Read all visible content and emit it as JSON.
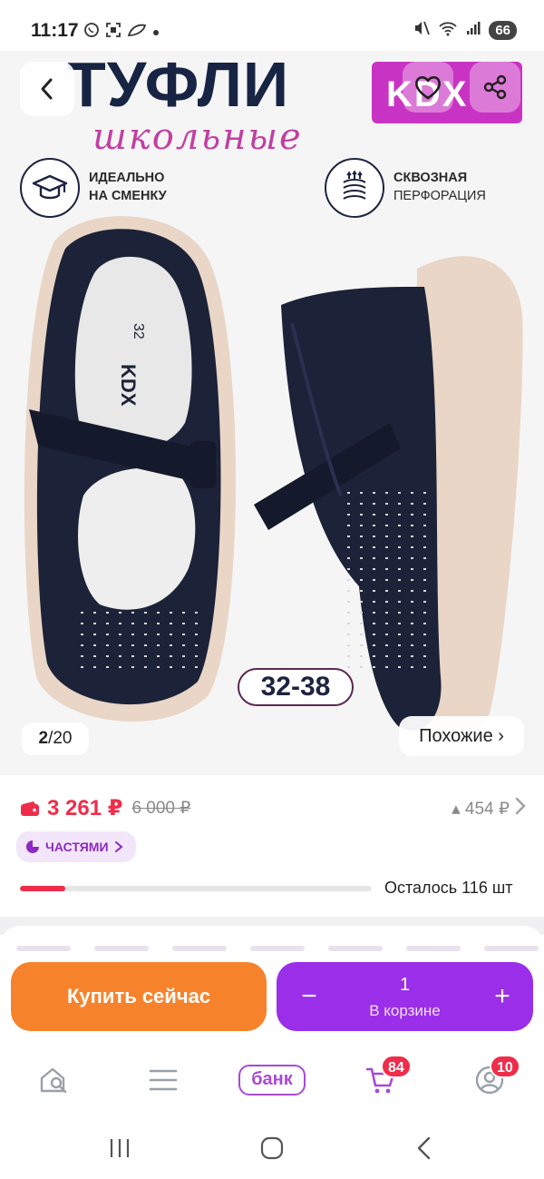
{
  "status_bar": {
    "time": "11:17",
    "battery": "66",
    "left_icons": [
      "whatsapp-icon",
      "scan-icon",
      "leaf-icon",
      "dot-icon"
    ],
    "right_icons": [
      "mute-icon",
      "wifi-icon",
      "signal-icon"
    ]
  },
  "gallery": {
    "hero_title": "ТУФЛИ",
    "hero_subtitle": "школьные",
    "brand_logo": "KDX",
    "features": [
      {
        "line1": "ИДЕАЛЬНО",
        "line2": "НА СМЕНКУ",
        "icon": "graduation-cap-icon"
      },
      {
        "line1": "СКВОЗНАЯ",
        "line2": "ПЕРФОРАЦИЯ",
        "icon": "perforation-icon"
      }
    ],
    "size_range": "32-38",
    "insole_size": "32",
    "insole_brand": "KDX",
    "photo_index": "2",
    "photo_total": "20",
    "similar_label": "Похожие ›"
  },
  "price": {
    "current": "3 261 ₽",
    "old": "6 000 ₽",
    "drop": "▴ 454 ₽",
    "parts_label": "ЧАСТЯМИ",
    "stock_text": "Осталось 116 шт",
    "stock_fraction": 0.13
  },
  "actions": {
    "buy_now": "Купить сейчас",
    "cart_qty": "1",
    "cart_label": "В корзине",
    "minus": "−",
    "plus": "+"
  },
  "tab_bar": {
    "bank_label": "банк",
    "cart_badge": "84",
    "profile_badge": "10"
  },
  "colors": {
    "accent_purple": "#9b2ee8",
    "buy_orange": "#f6832b",
    "price_red": "#ef2d4b",
    "brand_magenta": "#c933c4"
  }
}
